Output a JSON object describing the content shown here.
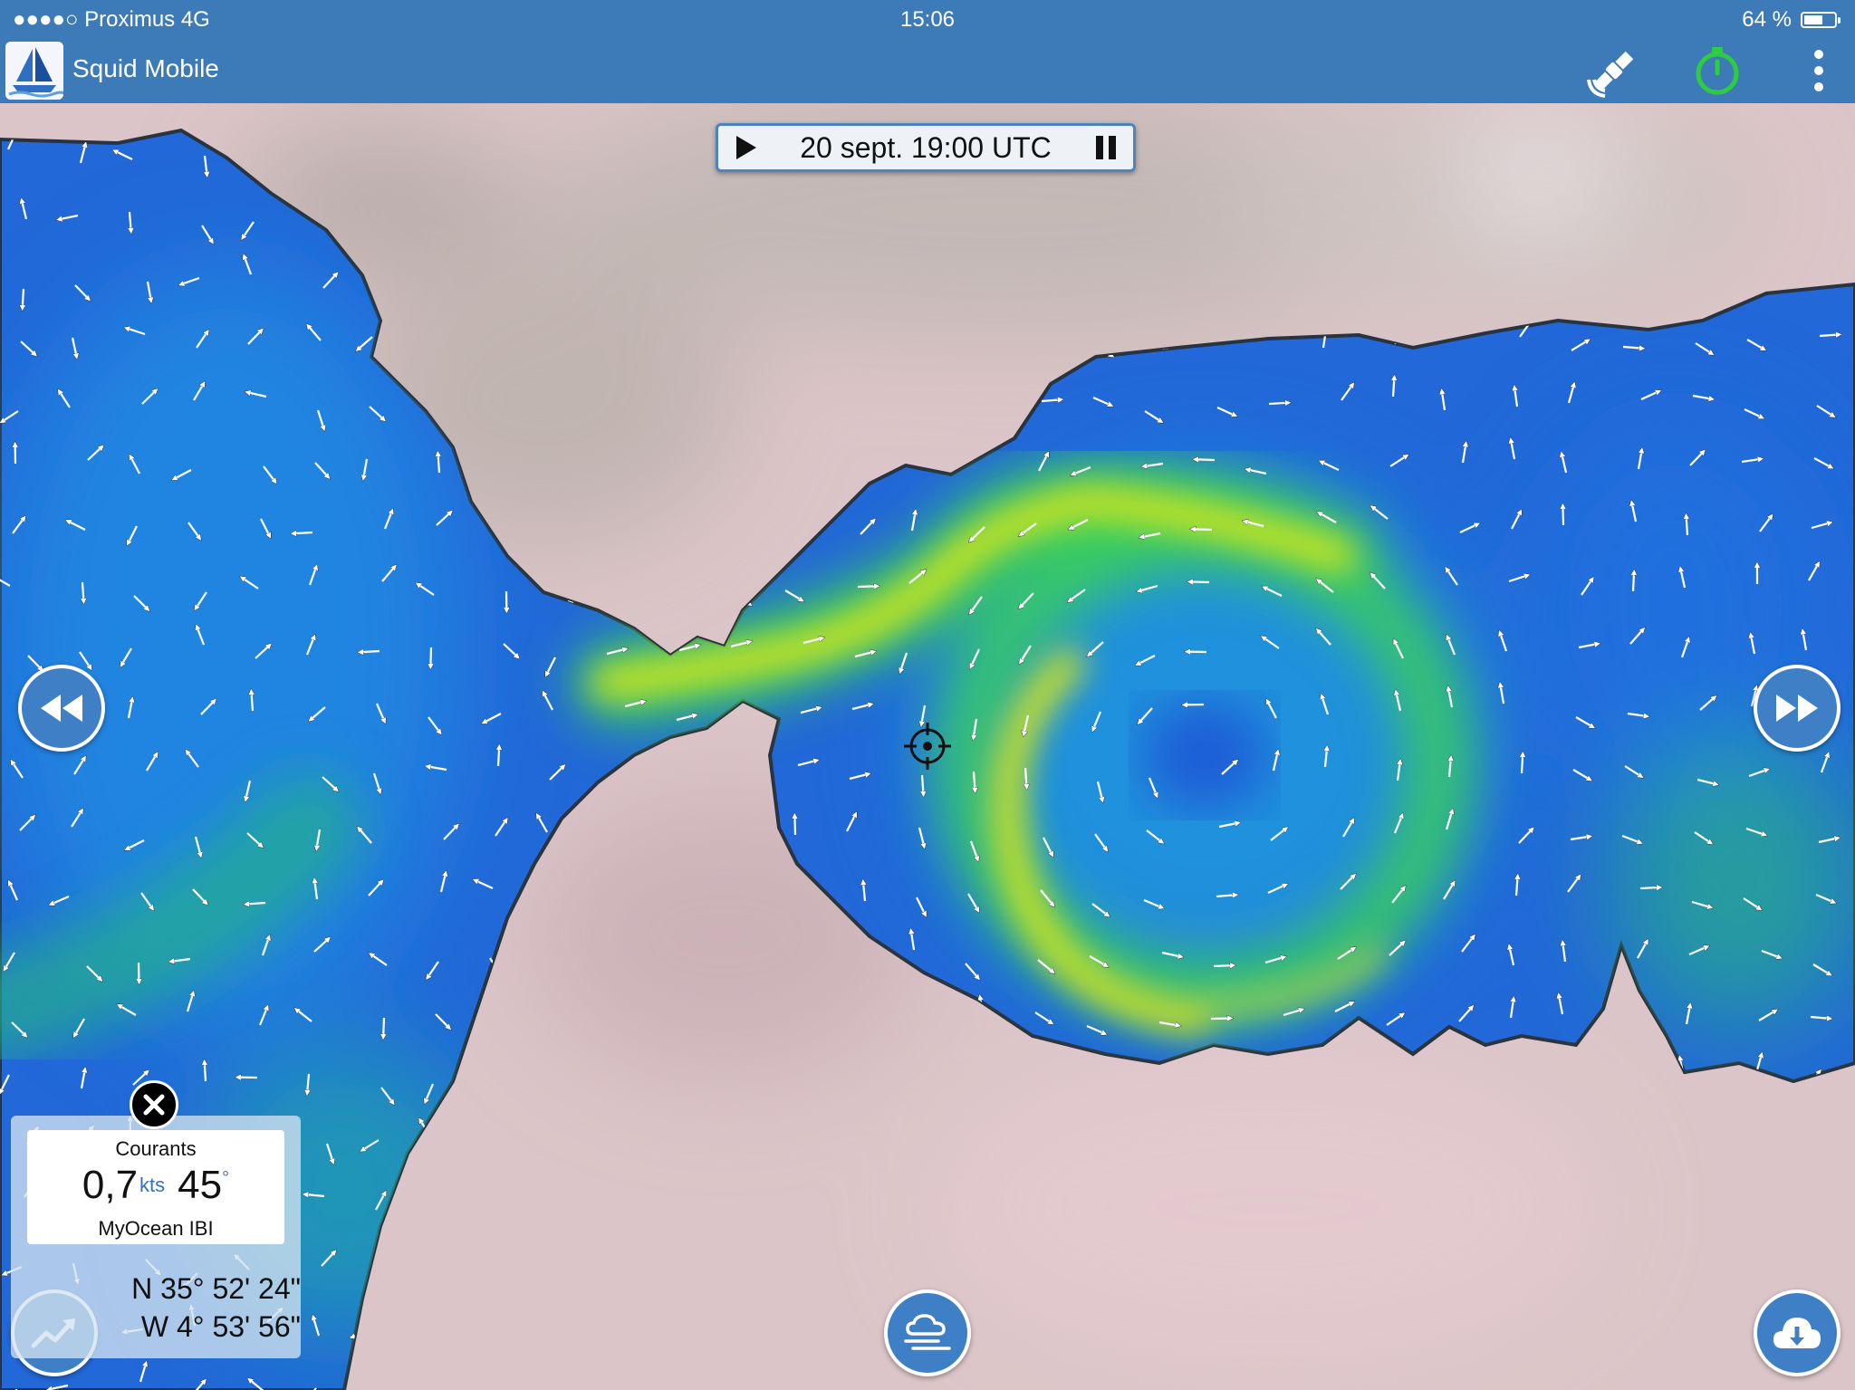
{
  "status_bar": {
    "carrier": "●●●●○ Proximus  4G",
    "time": "15:06",
    "battery": "64 %",
    "battery_level": 0.64
  },
  "app_bar": {
    "title": "Squid Mobile",
    "icons": [
      "boat-logo-icon",
      "gps-satellite-icon",
      "stopwatch-icon",
      "more-vertical-icon"
    ],
    "stopwatch_color": "#2ecc40"
  },
  "time_control": {
    "timestamp": "20 sept. 19:00 UTC"
  },
  "nav": {
    "rewind": "rewind-icon",
    "fast_forward": "fast-forward-icon",
    "weather": "weather-icon",
    "chart": "trend-chart-icon",
    "download": "cloud-download-icon"
  },
  "info_panel": {
    "layer": "Courants",
    "speed": "0,7",
    "speed_unit": "kts",
    "direction": "45",
    "direction_unit": "°",
    "source": "MyOcean IBI",
    "lat": "N 35° 52' 24\"",
    "lon": "W 4° 53' 56\""
  },
  "colors": {
    "bar": "#3d7bb8",
    "button": "#3e7fc6",
    "sea_deep": "#1f4fd6",
    "sea_mid": "#1f9de8",
    "current_green": "#3cd05a",
    "current_yellow": "#d6e41c",
    "land": "#d9c2c4"
  }
}
